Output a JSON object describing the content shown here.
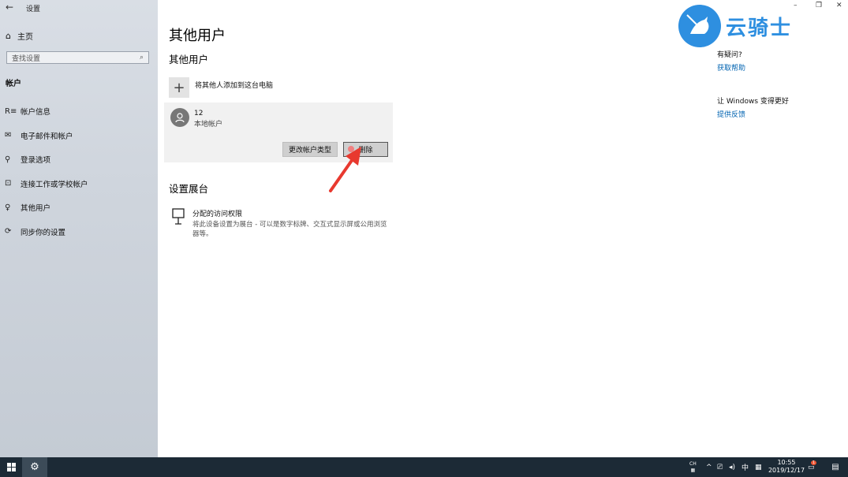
{
  "window": {
    "title": "设置",
    "back_glyph": "←",
    "controls": {
      "minimize": "–",
      "maximize": "❐",
      "close": "✕"
    }
  },
  "sidebar": {
    "home_label": "主页",
    "search_placeholder": "查找设置",
    "section_title": "帐户",
    "items": [
      {
        "label": "帐户信息",
        "icon": "person-card-icon"
      },
      {
        "label": "电子邮件和帐户",
        "icon": "mail-icon"
      },
      {
        "label": "登录选项",
        "icon": "key-icon"
      },
      {
        "label": "连接工作或学校帐户",
        "icon": "briefcase-icon"
      },
      {
        "label": "其他用户",
        "icon": "person-icon"
      },
      {
        "label": "同步你的设置",
        "icon": "sync-icon"
      }
    ]
  },
  "main": {
    "title": "其他用户",
    "subtitle": "其他用户",
    "add_label": "将其他人添加到这台电脑",
    "user": {
      "name": "12",
      "type": "本地帐户"
    },
    "buttons": {
      "change_type": "更改帐户类型",
      "delete": "删除"
    },
    "kiosk": {
      "title": "设置展台",
      "name": "分配的访问权限",
      "description": "将此设备设置为展台 - 可以是数字标牌、交互式显示屏或公用浏览器等。"
    }
  },
  "help": {
    "question": "有疑问?",
    "help_link": "获取帮助",
    "improve": "让 Windows 变得更好",
    "feedback_link": "提供反馈"
  },
  "watermark": {
    "text": "云骑士"
  },
  "taskbar": {
    "ime_top": "CH",
    "lang": "中",
    "time": "10:55",
    "date": "2019/12/17",
    "notif_count": "1"
  },
  "colors": {
    "accent": "#0063b1",
    "taskbar": "#1c2a36",
    "watermark": "#2e8fe0",
    "arrow": "#e8392f"
  }
}
